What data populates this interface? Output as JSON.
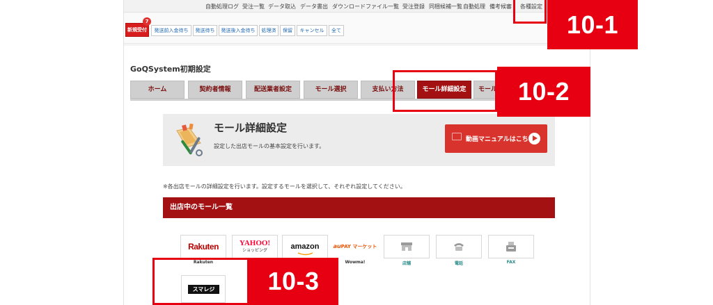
{
  "top_menu": [
    "自動処理ログ",
    "受注一覧",
    "データ取込",
    "データ書出",
    "ダウンロードファイル一覧",
    "受注登録",
    "同梱候補一覧",
    "自動処理",
    "備考候審",
    "各種設定"
  ],
  "status_tabs": [
    {
      "label": "新規受付",
      "badge": "7",
      "active": true
    },
    {
      "label": "発送前入金待ち"
    },
    {
      "label": "発送待ち"
    },
    {
      "label": "発送後入金待ち"
    },
    {
      "label": "処理済"
    },
    {
      "label": "保留"
    },
    {
      "label": "キャンセル"
    },
    {
      "label": "全て"
    }
  ],
  "page_title": "GoQSystem初期設定",
  "nav_tabs": [
    {
      "label": "ホーム"
    },
    {
      "label": "契約者情報"
    },
    {
      "label": "配送業者設定"
    },
    {
      "label": "モール選択"
    },
    {
      "label": "支払い方法"
    },
    {
      "label": "モール詳細設定",
      "active": true
    },
    {
      "label": "モール"
    }
  ],
  "header_card": {
    "title": "モール詳細設定",
    "description": "設定した出店モールの基本設定を行います。",
    "manual_button": "動画マニュアルはこちら"
  },
  "note": "※各出店モールの詳細設定を行います。設定するモールを選択して、それぞれ設定してください。",
  "mall_list": {
    "header": "出店中のモール一覧",
    "malls": [
      {
        "logo": "Rakuten",
        "label": "Rakuten"
      },
      {
        "logo_main": "YAHOO!",
        "logo_sub": "ショッピング",
        "label": ""
      },
      {
        "logo": "amazon",
        "label": ""
      },
      {
        "logo_au": "au",
        "logo_pay": "PAY マーケット",
        "label": "Wowma!"
      },
      {
        "icon": "shop-icon",
        "label": "店舗"
      },
      {
        "icon": "phone-icon",
        "label": "電話"
      },
      {
        "icon": "fax-icon",
        "label": "FAX"
      }
    ],
    "sumaregi": "スマレジ"
  },
  "callouts": {
    "c1": "10-1",
    "c2": "10-2",
    "c3": "10-3"
  },
  "colors": {
    "annotation_red": "#e60012",
    "nav_active": "#a41113",
    "header_bar": "#a31113",
    "manual_button": "#d9332d"
  }
}
